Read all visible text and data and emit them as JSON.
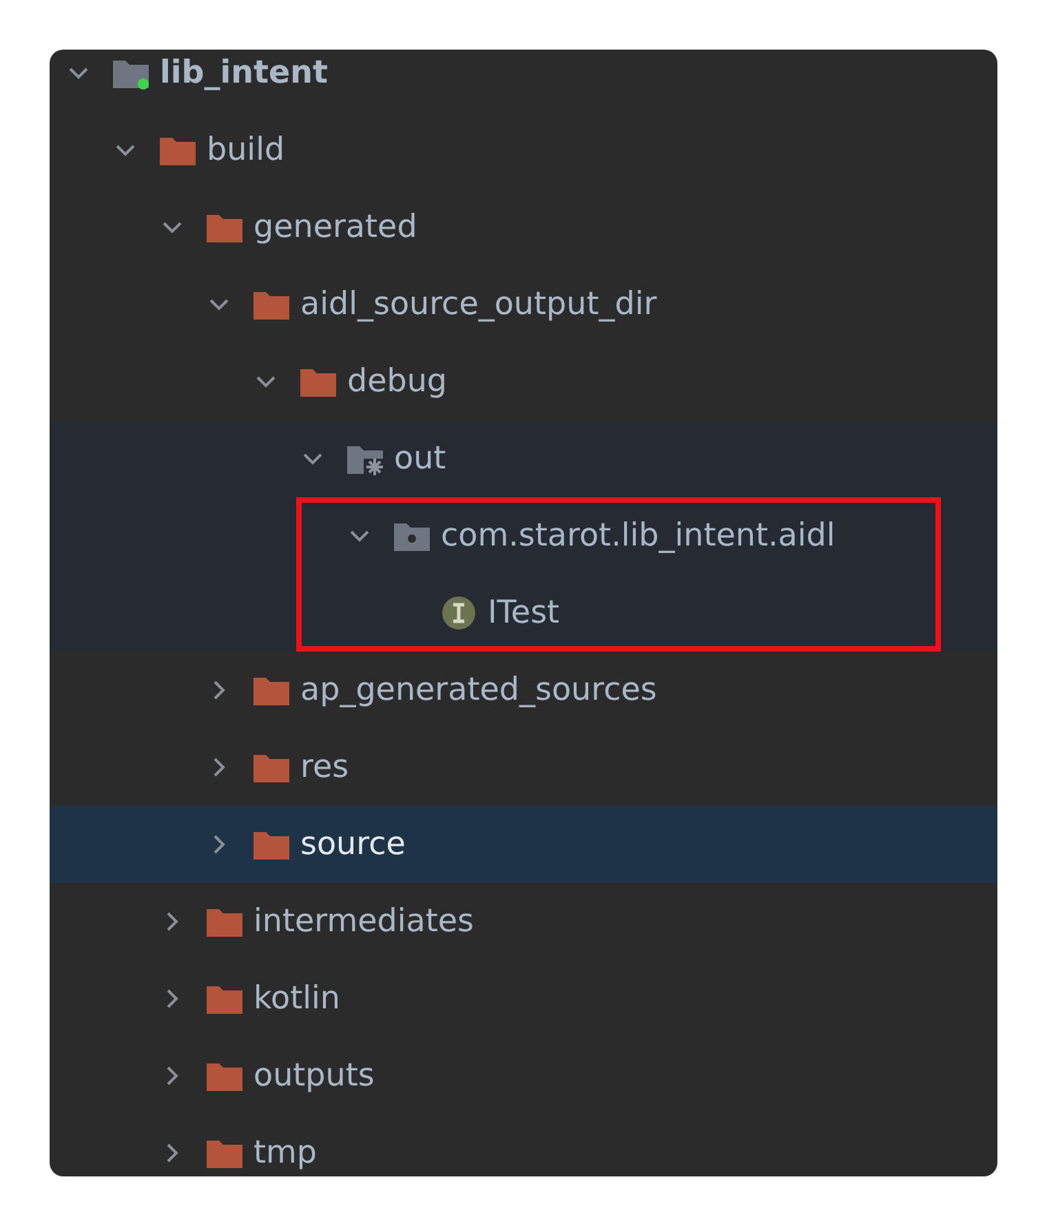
{
  "tree": [
    {
      "label": "lib_intent",
      "kind": "module",
      "expanded": true,
      "selected": false,
      "children": [
        {
          "label": "build",
          "kind": "folder",
          "expanded": true,
          "selected": false,
          "children": [
            {
              "label": "generated",
              "kind": "folder",
              "expanded": true,
              "selected": false,
              "children": [
                {
                  "label": "aidl_source_output_dir",
                  "kind": "folder",
                  "expanded": true,
                  "selected": false,
                  "children": [
                    {
                      "label": "debug",
                      "kind": "folder",
                      "expanded": true,
                      "selected": false,
                      "children": [
                        {
                          "label": "out",
                          "kind": "generated",
                          "expanded": true,
                          "selected": false,
                          "in_scope": true,
                          "children": [
                            {
                              "label": "com.starot.lib_intent.aidl",
                              "kind": "package",
                              "expanded": true,
                              "selected": false,
                              "boxed": true,
                              "children": [
                                {
                                  "label": "ITest",
                                  "kind": "interface",
                                  "selected": false
                                }
                              ]
                            }
                          ]
                        }
                      ]
                    }
                  ]
                },
                {
                  "label": "ap_generated_sources",
                  "kind": "folder",
                  "expanded": false,
                  "selected": false
                },
                {
                  "label": "res",
                  "kind": "folder",
                  "expanded": false,
                  "selected": false
                },
                {
                  "label": "source",
                  "kind": "folder",
                  "expanded": false,
                  "selected": true
                }
              ]
            },
            {
              "label": "intermediates",
              "kind": "folder",
              "expanded": false,
              "selected": false
            },
            {
              "label": "kotlin",
              "kind": "folder",
              "expanded": false,
              "selected": false
            },
            {
              "label": "outputs",
              "kind": "folder",
              "expanded": false,
              "selected": false
            },
            {
              "label": "tmp",
              "kind": "folder",
              "expanded": false,
              "selected": false
            }
          ]
        }
      ]
    }
  ]
}
